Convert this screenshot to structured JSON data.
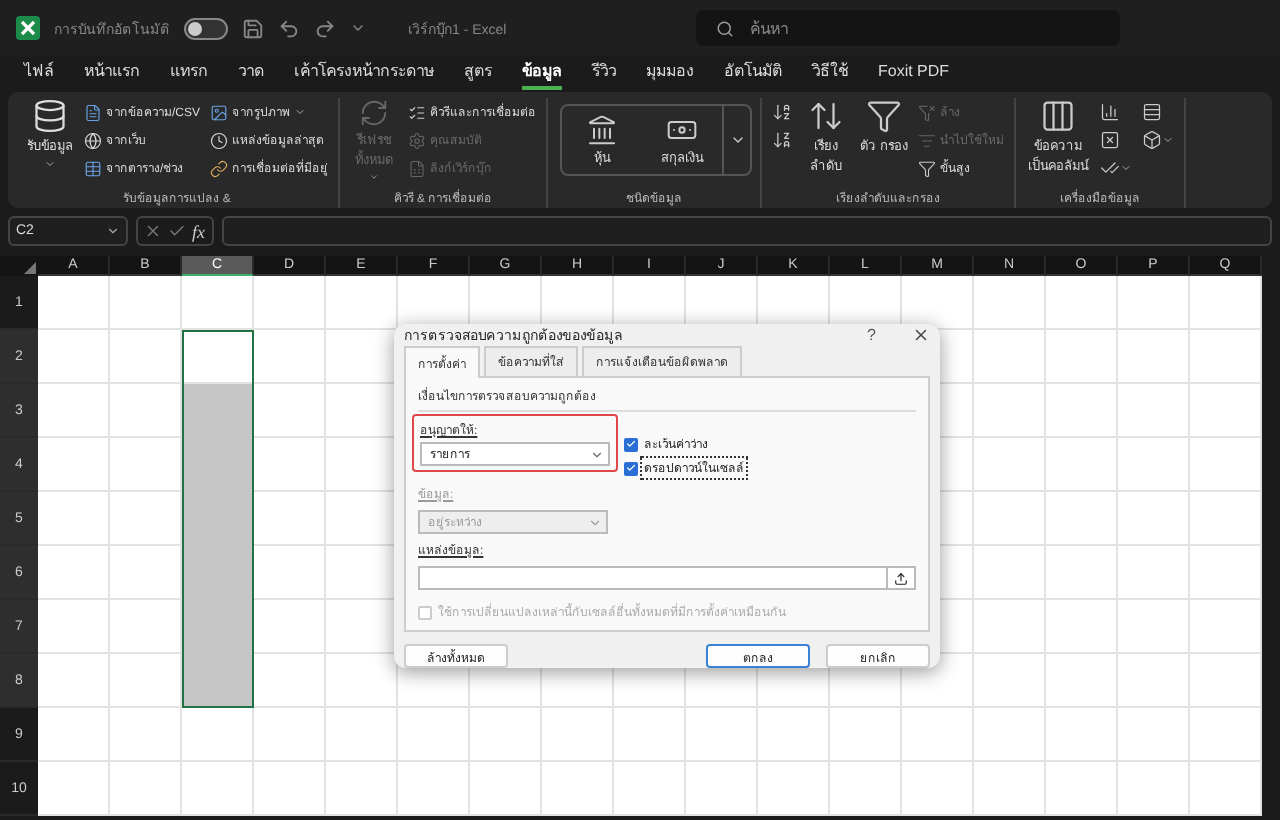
{
  "title_bar": {
    "autosave_label": "การบันทึกอัตโนมัติ",
    "autosave_on": false,
    "document_title": "เวิร์กบุ๊ก1  -  Excel",
    "search_placeholder": "ค้นหา"
  },
  "tabs": [
    {
      "label": "ไฟล์",
      "selected": false
    },
    {
      "label": "หน้าแรก",
      "selected": false
    },
    {
      "label": "แทรก",
      "selected": false
    },
    {
      "label": "วาด",
      "selected": false
    },
    {
      "label": "เค้าโครงหน้ากระดาษ",
      "selected": false
    },
    {
      "label": "สูตร",
      "selected": false
    },
    {
      "label": "ข้อมูล",
      "selected": true
    },
    {
      "label": "รีวิว",
      "selected": false
    },
    {
      "label": "มุมมอง",
      "selected": false
    },
    {
      "label": "อัตโนมัติ",
      "selected": false
    },
    {
      "label": "วิธีใช้",
      "selected": false
    },
    {
      "label": "Foxit PDF",
      "selected": false
    }
  ],
  "ribbon_groups": [
    {
      "label": "รับข้อมูลการแปลง &",
      "items": [
        {
          "kind": "large",
          "label": "รับข้อมูล",
          "disabled": false,
          "has_menu": true
        },
        {
          "kind": "small",
          "label": "จากข้อความ/CSV",
          "disabled": false
        },
        {
          "kind": "small",
          "label": "จากเว็บ",
          "disabled": false
        },
        {
          "kind": "small",
          "label": "จากตาราง/ช่วง",
          "disabled": false
        },
        {
          "kind": "small",
          "label": "จากรูปภาพ",
          "disabled": false,
          "has_menu": true
        },
        {
          "kind": "small",
          "label": "แหล่งข้อมูลล่าสุด",
          "disabled": false
        },
        {
          "kind": "small",
          "label": "การเชื่อมต่อที่มีอยู่",
          "disabled": false
        }
      ]
    },
    {
      "label": "คิวรี & การเชื่อมต่อ",
      "items": [
        {
          "kind": "large",
          "label": "รีเฟรชทั้งหมด",
          "disabled": true,
          "has_menu": true
        },
        {
          "kind": "small",
          "label": "คิวรีและการเชื่อมต่อ",
          "disabled": false
        },
        {
          "kind": "small",
          "label": "คุณสมบัติ",
          "disabled": true
        },
        {
          "kind": "small",
          "label": "ลิงก์เวิร์กบุ๊ก",
          "disabled": true
        }
      ]
    },
    {
      "label": "ชนิดข้อมูล",
      "items": [
        {
          "kind": "gallery",
          "label": "หุ้น",
          "disabled": false
        },
        {
          "kind": "gallery",
          "label": "สกุลเงิน",
          "disabled": false
        }
      ]
    },
    {
      "label": "เรียงลำดับและกรอง",
      "items": [
        {
          "kind": "icon",
          "disabled": false
        },
        {
          "kind": "icon",
          "disabled": false
        },
        {
          "kind": "large",
          "label": "เรียง ลำดับ",
          "disabled": false
        },
        {
          "kind": "large",
          "label": "ตัว กรอง",
          "disabled": false
        },
        {
          "kind": "small",
          "label": "ล้าง",
          "disabled": true
        },
        {
          "kind": "small",
          "label": "นำไปใช้ใหม่",
          "disabled": true
        },
        {
          "kind": "small",
          "label": "ขั้นสูง",
          "disabled": false
        }
      ]
    },
    {
      "label": "เครื่องมือข้อมูล",
      "items": [
        {
          "kind": "large",
          "label": "ข้อความ เป็นคอลัมน์",
          "disabled": false
        },
        {
          "kind": "icon",
          "disabled": false
        },
        {
          "kind": "icon",
          "disabled": false
        },
        {
          "kind": "icon",
          "disabled": false,
          "has_menu": true
        },
        {
          "kind": "icon",
          "disabled": false
        },
        {
          "kind": "icon",
          "disabled": false,
          "has_menu": true
        }
      ]
    }
  ],
  "formula_bar": {
    "name_box": "C2",
    "function_label": "fx"
  },
  "sheet": {
    "columns": [
      {
        "label": "A",
        "selected": false
      },
      {
        "label": "B",
        "selected": false
      },
      {
        "label": "C",
        "selected": true
      },
      {
        "label": "D",
        "selected": false
      },
      {
        "label": "E",
        "selected": false
      },
      {
        "label": "F",
        "selected": false
      },
      {
        "label": "G",
        "selected": false
      },
      {
        "label": "H",
        "selected": false
      },
      {
        "label": "I",
        "selected": false
      },
      {
        "label": "J",
        "selected": false
      },
      {
        "label": "K",
        "selected": false
      },
      {
        "label": "L",
        "selected": false
      },
      {
        "label": "M",
        "selected": false
      },
      {
        "label": "N",
        "selected": false
      },
      {
        "label": "O",
        "selected": false
      },
      {
        "label": "P",
        "selected": false
      },
      {
        "label": "Q",
        "selected": false
      }
    ],
    "rows": [
      {
        "label": "1",
        "selected": false
      },
      {
        "label": "2",
        "selected": true
      },
      {
        "label": "3",
        "selected": true
      },
      {
        "label": "4",
        "selected": true
      },
      {
        "label": "5",
        "selected": true
      },
      {
        "label": "6",
        "selected": true
      },
      {
        "label": "7",
        "selected": true
      },
      {
        "label": "8",
        "selected": true
      },
      {
        "label": "9",
        "selected": false
      },
      {
        "label": "10",
        "selected": false
      }
    ]
  },
  "dialog": {
    "title": "การตรวจสอบความถูกต้องของข้อมูล",
    "help_label": "?",
    "tabs": [
      {
        "label": "การตั้งค่า",
        "selected": true
      },
      {
        "label": "ข้อความที่ใส่",
        "selected": false
      },
      {
        "label": "การแจ้งเตือนข้อผิดพลาด",
        "selected": false
      }
    ],
    "section_title": "เงื่อนไขการตรวจสอบความถูกต้อง",
    "allow": {
      "label": "อนุญาตให้:",
      "value": "รายการ",
      "highlighted": true
    },
    "checkboxes": [
      {
        "label": "ละเว้นค่าว่าง",
        "checked": true,
        "focused": false
      },
      {
        "label": "ดรอปดาวน์ในเซลล์",
        "checked": true,
        "focused": true
      }
    ],
    "data": {
      "label": "ข้อมูล:",
      "value": "อยู่ระหว่าง",
      "disabled": true
    },
    "source": {
      "label": "แหล่งข้อมูล:"
    },
    "apply_all": {
      "label": "ใช้การเปลี่ยนแปลงเหล่านี้กับเซลล์อื่นทั้งหมดที่มีการตั้งค่าเหมือนกัน",
      "checked": false,
      "disabled": true
    },
    "buttons": [
      {
        "label": "ล้างทั้งหมด",
        "kind": "secondary"
      },
      {
        "label": "ตกลง",
        "kind": "primary"
      },
      {
        "label": "ยกเลิก",
        "kind": "secondary"
      }
    ]
  }
}
